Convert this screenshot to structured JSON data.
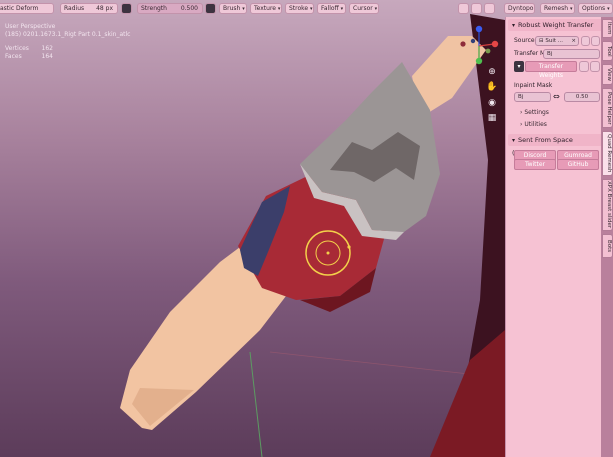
{
  "header": {
    "mode": "astic Deform",
    "radius_label": "Radius",
    "radius_value": "48 px",
    "strength_label": "Strength",
    "strength_value": "0.500",
    "menus": [
      "Brush",
      "Texture",
      "Stroke",
      "Falloff",
      "Cursor"
    ],
    "right_buttons": [
      "Dyntopo",
      "Remesh",
      "Options"
    ]
  },
  "viewport": {
    "view": "User Perspective",
    "object": "(185) 0201.1673.1_Rigt Part 0.1_skin_atlc",
    "stats": [
      {
        "label": "Vertices",
        "value": "162"
      },
      {
        "label": "Faces",
        "value": "164"
      }
    ]
  },
  "colors": {
    "accent": "#e79bb7",
    "panel": "#f6c2d3",
    "brush_ring": "#f3d04a"
  },
  "panel": {
    "robust_title": "Robust Weight Transfer",
    "source_label": "Source:",
    "source_value": "Suit ...",
    "transfer_label": "Transfer M...",
    "transfer_value": "Bj",
    "transfer_button": "Transfer Weights",
    "inpaint_label": "Inpaint Mask",
    "inpaint_value": "Bj",
    "inpaint_number": "0.50",
    "settings": "Settings",
    "utilities": "Utilities",
    "sent_title": "Sent From Space (@sentfro",
    "links": [
      "Discord",
      "Gumroad",
      "Twitter",
      "GitHub"
    ]
  },
  "tabs": [
    "Item",
    "Tool",
    "View",
    "Pose Helper",
    "Quad Remesh",
    "XPX Breast slider",
    "Bots"
  ]
}
